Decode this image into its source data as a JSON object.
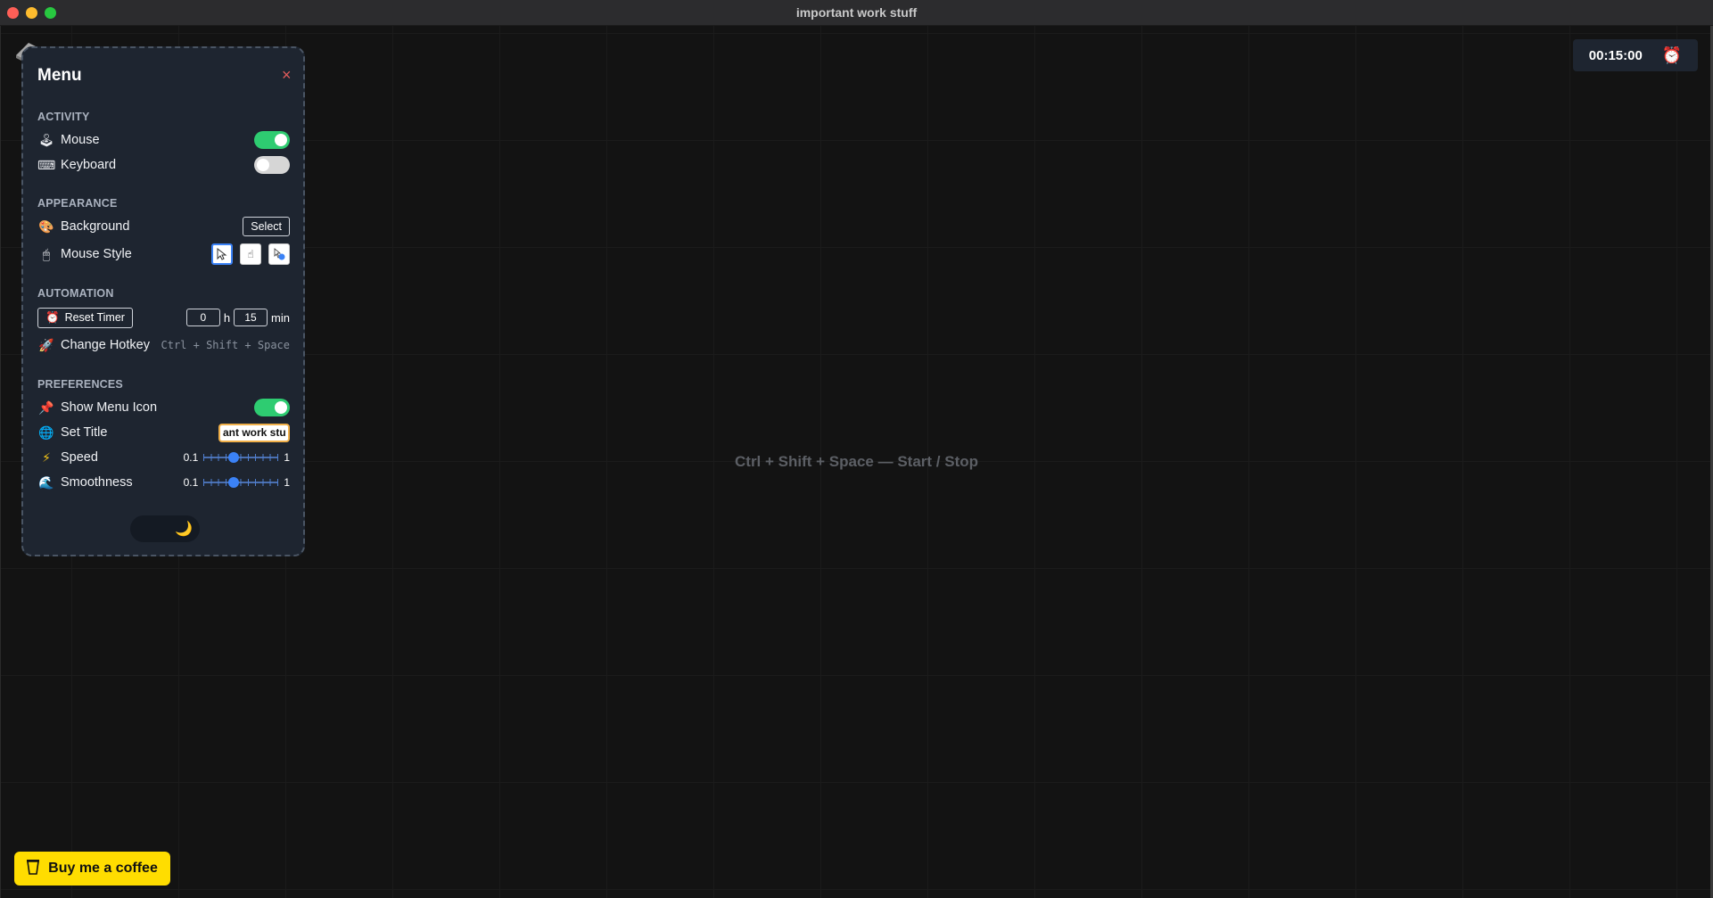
{
  "window": {
    "title": "important work stuff"
  },
  "timer": {
    "display": "00:15:00",
    "icon": "alarm-clock-icon"
  },
  "hint": "Ctrl + Shift + Space — Start / Stop",
  "menu": {
    "title": "Menu",
    "close_symbol": "×",
    "sections": {
      "activity": "ACTIVITY",
      "appearance": "APPEARANCE",
      "automation": "AUTOMATION",
      "preferences": "PREFERENCES"
    },
    "activity": {
      "mouse": {
        "label": "Mouse",
        "enabled": true,
        "icon": "joystick-icon"
      },
      "keyboard": {
        "label": "Keyboard",
        "enabled": false,
        "icon": "keyboard-icon"
      }
    },
    "appearance": {
      "background": {
        "label": "Background",
        "button": "Select",
        "icon": "palette-icon"
      },
      "mouse_style": {
        "label": "Mouse Style",
        "icon": "mouse-icon",
        "options": [
          "arrow-cursor",
          "hand-cursor",
          "dot-cursor"
        ],
        "selected": 0
      }
    },
    "automation": {
      "reset_timer": {
        "label": "Reset Timer",
        "icon": "alarm-clock-icon"
      },
      "hours": "0",
      "hours_unit": "h",
      "minutes": "15",
      "minutes_unit": "min",
      "change_hotkey": {
        "label": "Change Hotkey",
        "value": "Ctrl + Shift + Space",
        "icon": "rocket-icon"
      }
    },
    "preferences": {
      "show_menu_icon": {
        "label": "Show Menu Icon",
        "enabled": true,
        "icon": "pushpin-icon"
      },
      "set_title": {
        "label": "Set Title",
        "value": "ant work stuff",
        "icon": "globe-icon"
      },
      "speed": {
        "label": "Speed",
        "min": "0.1",
        "max": "1",
        "value": 0.4,
        "icon": "lightning-icon"
      },
      "smoothness": {
        "label": "Smoothness",
        "min": "0.1",
        "max": "1",
        "value": 0.4,
        "icon": "wave-icon"
      }
    },
    "theme_icon": "🌙"
  },
  "coffee": {
    "label": "Buy me a coffee",
    "icon": "coffee-cup-icon"
  },
  "colors": {
    "accent": "#2ecc71",
    "highlight": "#3b82f6",
    "coffee": "#ffdd00",
    "panel": "#1e2530"
  }
}
